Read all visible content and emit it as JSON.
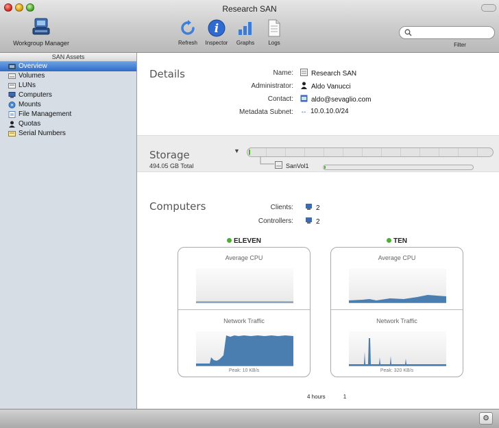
{
  "window": {
    "title": "Research SAN"
  },
  "toolbar": {
    "app_label": "Workgroup Manager",
    "buttons": [
      {
        "label": "Refresh",
        "icon": "refresh-icon"
      },
      {
        "label": "Inspector",
        "icon": "info-icon"
      },
      {
        "label": "Graphs",
        "icon": "bar-graph-icon"
      },
      {
        "label": "Logs",
        "icon": "document-icon"
      }
    ],
    "filter_label": "Filter",
    "filter_value": ""
  },
  "sidebar": {
    "header": "SAN Assets",
    "items": [
      {
        "label": "Overview",
        "selected": true
      },
      {
        "label": "Volumes"
      },
      {
        "label": "LUNs"
      },
      {
        "label": "Computers"
      },
      {
        "label": "Mounts"
      },
      {
        "label": "File Management"
      },
      {
        "label": "Quotas"
      },
      {
        "label": "Serial Numbers"
      }
    ]
  },
  "details": {
    "title": "Details",
    "name_label": "Name:",
    "name_value": "Research SAN",
    "admin_label": "Administrator:",
    "admin_value": "Aldo Vanucci",
    "contact_label": "Contact:",
    "contact_value": "aldo@sevaglio.com",
    "subnet_label": "Metadata Subnet:",
    "subnet_value": "10.0.10.0/24"
  },
  "storage": {
    "title": "Storage",
    "total": "494.05 GB Total",
    "volume_name": "SanVol1",
    "used_fraction": 0.005
  },
  "computers": {
    "title": "Computers",
    "clients_label": "Clients:",
    "clients_value": "2",
    "controllers_label": "Controllers:",
    "controllers_value": "2",
    "hosts": [
      {
        "name": "ELEVEN",
        "status_color": "#4caf30",
        "cpu_label": "Average CPU",
        "net_label": "Network Traffic",
        "peak": "Peak: 10 KB/s"
      },
      {
        "name": "TEN",
        "status_color": "#4caf30",
        "cpu_label": "Average CPU",
        "net_label": "Network Traffic",
        "peak": "Peak: 320 KB/s"
      }
    ],
    "time_range": "4 hours",
    "time_page": "1"
  },
  "colors": {
    "accent": "#2d6ac8",
    "graph_fill": "#4a7db0",
    "status_green": "#4caf30"
  }
}
